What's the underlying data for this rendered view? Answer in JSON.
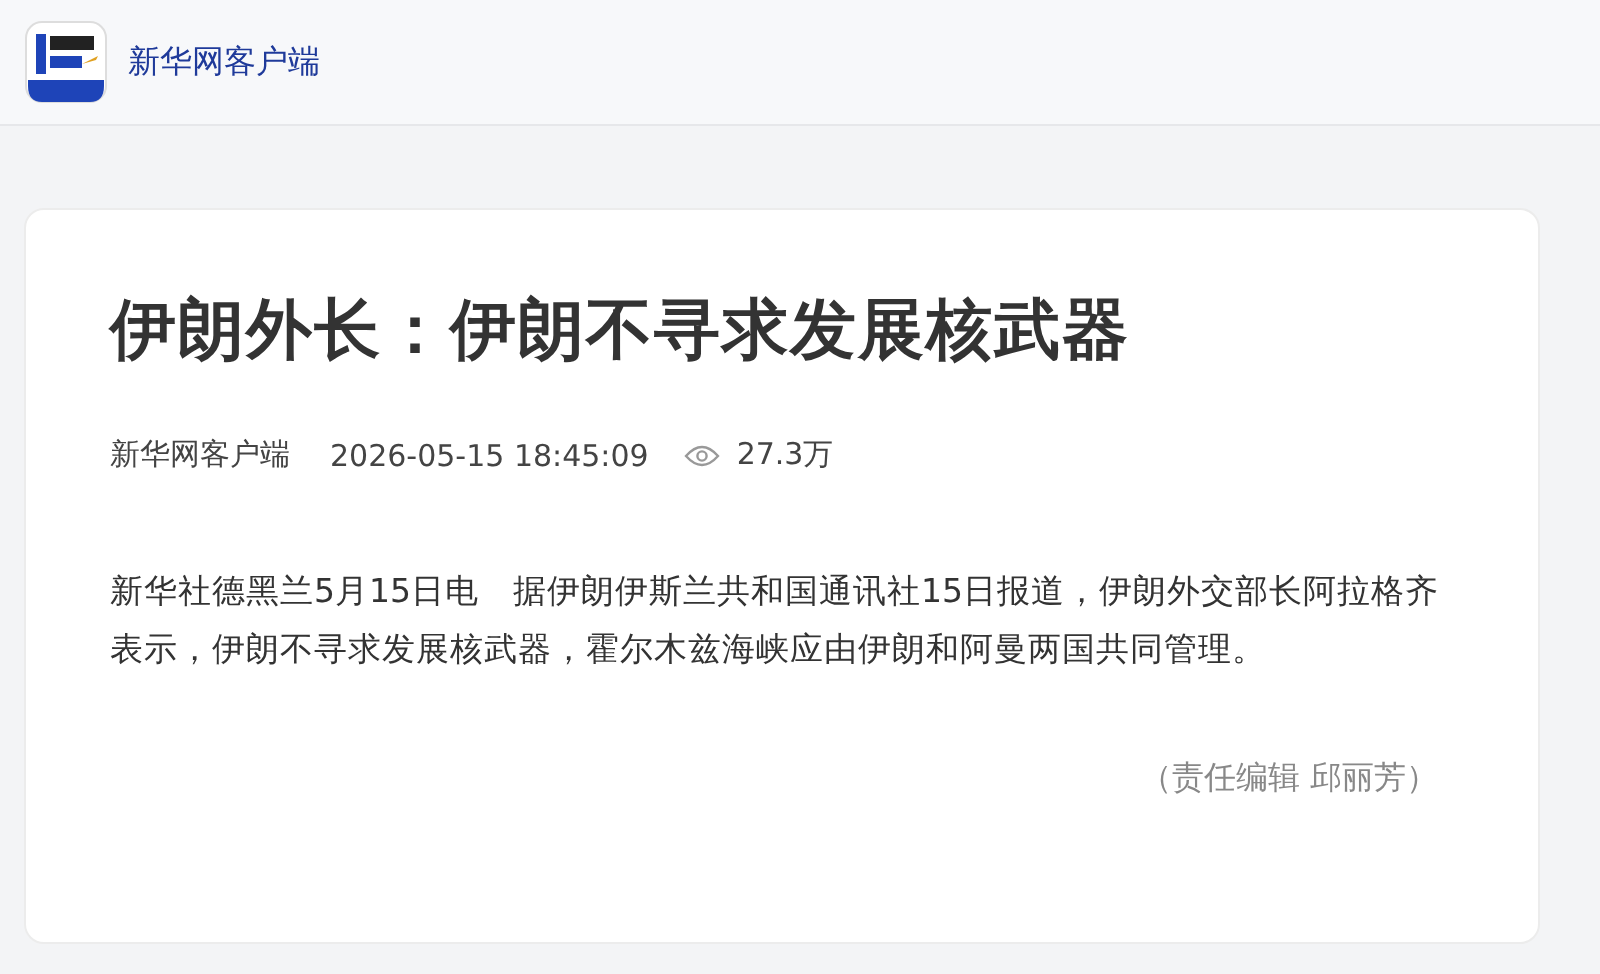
{
  "header": {
    "app_name": "新华网客户端"
  },
  "article": {
    "title": "伊朗外长：伊朗不寻求发展核武器",
    "source": "新华网客户端",
    "time": "2026-05-15 18:45:09",
    "views": "27.3万",
    "body": "新华社德黑兰5月15日电　据伊朗伊斯兰共和国通讯社15日报道，伊朗外交部长阿拉格齐表示，伊朗不寻求发展核武器，霍尔木兹海峡应由伊朗和阿曼两国共同管理。",
    "editor": "（责任编辑 邱丽芳）"
  }
}
